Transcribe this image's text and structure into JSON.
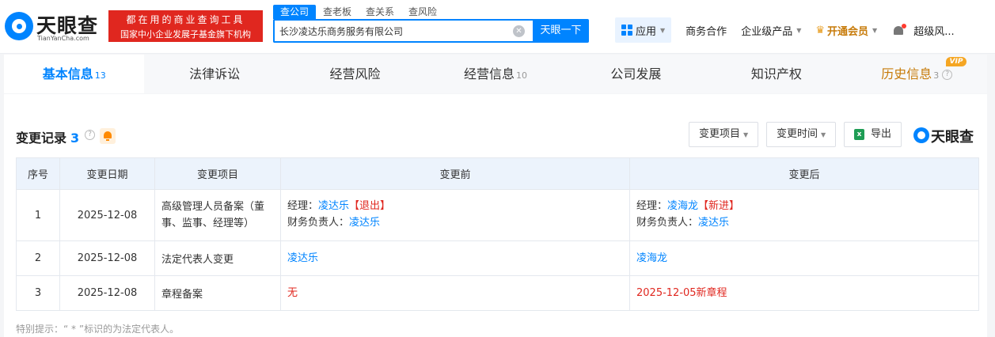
{
  "brand": {
    "name": "天眼查",
    "domain": "TianYanCha.com",
    "primary_color": "#0084ff"
  },
  "slogan": {
    "line1": "都在用的商业查询工具",
    "line2": "国家中小企业发展子基金旗下机构",
    "bg_color": "#e0271f"
  },
  "search": {
    "tabs": [
      "查公司",
      "查老板",
      "查关系",
      "查风险"
    ],
    "active_tab": "查公司",
    "value": "长沙凌达乐商务服务有限公司",
    "button_label": "天眼一下"
  },
  "nav": {
    "app_label": "应用",
    "business": "商务合作",
    "enterprise": "企业级产品",
    "vip": "开通会员",
    "user": "超级风..."
  },
  "tabs": [
    {
      "label": "基本信息",
      "count": "13",
      "active": true
    },
    {
      "label": "法律诉讼",
      "count": ""
    },
    {
      "label": "经营风险",
      "count": ""
    },
    {
      "label": "经营信息",
      "count": "10"
    },
    {
      "label": "公司发展",
      "count": ""
    },
    {
      "label": "知识产权",
      "count": ""
    },
    {
      "label": "历史信息",
      "count": "3",
      "badge": "VIP"
    }
  ],
  "section": {
    "title": "变更记录",
    "count": "3",
    "filter_item": "变更项目",
    "filter_time": "变更时间",
    "export": "导出",
    "watermark": "天眼查"
  },
  "table": {
    "headers": [
      "序号",
      "变更日期",
      "变更项目",
      "变更前",
      "变更后"
    ],
    "rows": [
      {
        "no": "1",
        "date": "2025-12-08",
        "item": "高级管理人员备案（董事、监事、经理等）",
        "before": {
          "line1_label": "经理：",
          "line1_name": "凌达乐",
          "line1_tag": "【退出】",
          "line2_label": "财务负责人：",
          "line2_name": "凌达乐"
        },
        "after": {
          "line1_label": "经理：",
          "line1_name": "凌海龙",
          "line1_tag": "【新进】",
          "line2_label": "财务负责人：",
          "line2_name": "凌达乐"
        }
      },
      {
        "no": "2",
        "date": "2025-12-08",
        "item": "法定代表人变更",
        "before": "凌达乐",
        "after": "凌海龙"
      },
      {
        "no": "3",
        "date": "2025-12-08",
        "item": "章程备案",
        "before": "无",
        "after": "2025-12-05新章程"
      }
    ]
  },
  "tips": "特别提示：“ * ”标识的为法定代表人。"
}
